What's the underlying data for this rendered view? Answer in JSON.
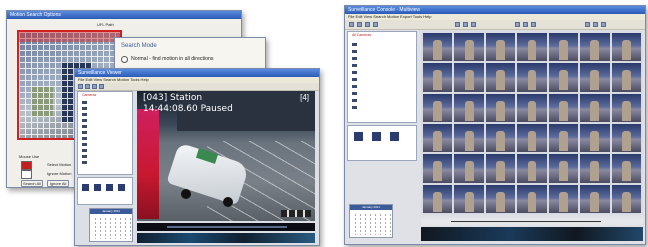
{
  "left_group": {
    "motion_dialog": {
      "title": "Motion Search Options",
      "field_label": "UFL Path",
      "search_mode_title": "Search Mode",
      "search_mode_option": "Normal - find motion in all directions",
      "legend_title": "Mouse Use",
      "legend_select": "Select Motion",
      "legend_ignore": "Ignore Motion",
      "ok_label": "Search All",
      "cancel_label": "Ignore All"
    },
    "viewer_window": {
      "title": "Surveillance Viewer",
      "menu": "File  Edit  View  Search  Motion  Tools  Help",
      "overlay_channel": "[043] Station",
      "overlay_time": "14:44:08.60 Paused",
      "overlay_index": "[4]",
      "tree_header": "Cameras",
      "calendar_month": "January 2011"
    }
  },
  "right_window": {
    "title": "Surveillance Console - Multiview",
    "menu": "File  Edit  View  Search  Motion  Export  Tools  Help",
    "tree_header": "All Cameras",
    "calendar_month": "January 2011",
    "grid_rows": 6,
    "grid_cols": 7
  }
}
